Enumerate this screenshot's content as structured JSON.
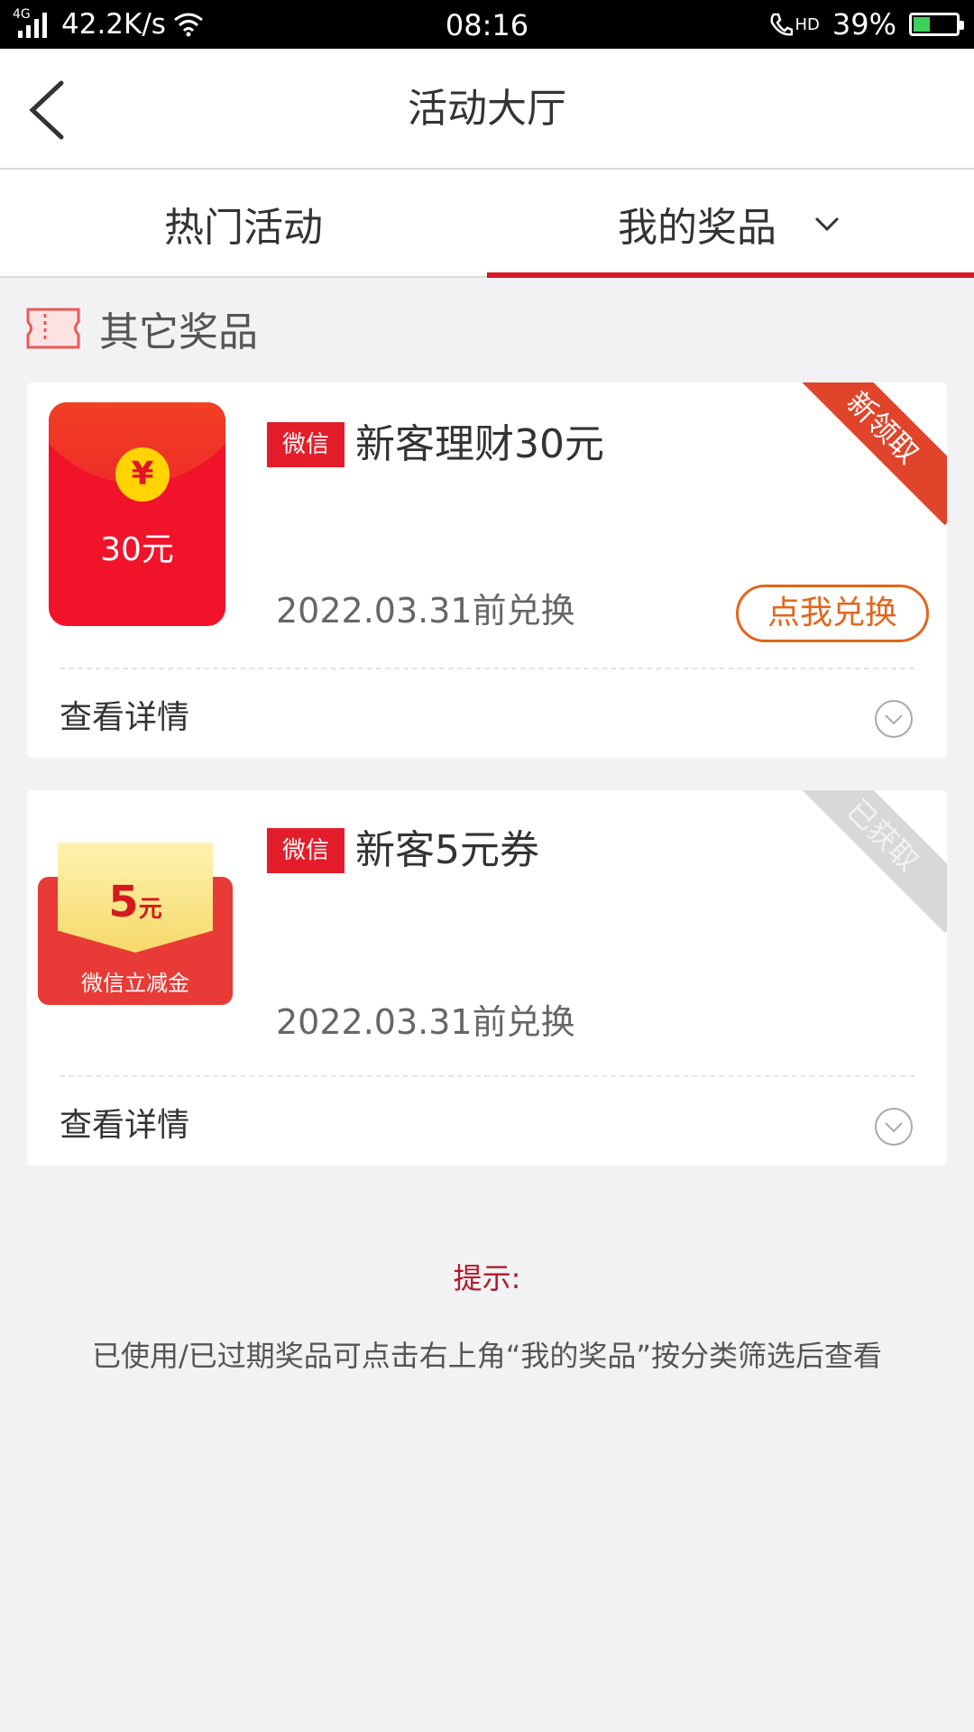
{
  "status_bar": {
    "network": "4G",
    "speed": "42.2K/s",
    "time": "08:16",
    "call_hd": "HD",
    "battery": "39%",
    "battery_level": 0.39
  },
  "header": {
    "title": "活动大厅"
  },
  "tabs": [
    {
      "label": "热门活动",
      "active": false
    },
    {
      "label": "我的奖品",
      "active": true
    }
  ],
  "section": {
    "title": "其它奖品"
  },
  "prizes": [
    {
      "thumb_amount": "30元",
      "thumb_symbol": "¥",
      "tag": "微信",
      "name": "新客理财30元",
      "expire": "2022.03.31前兑换",
      "ribbon": "新领取",
      "redeem_label": "点我兑换",
      "detail_label": "查看详情"
    },
    {
      "thumb_amount": "5",
      "thumb_unit": "元",
      "thumb_sub": "微信立减金",
      "tag": "微信",
      "name": "新客5元券",
      "expire": "2022.03.31前兑换",
      "ribbon": "已获取",
      "detail_label": "查看详情"
    }
  ],
  "tip": {
    "title": "提示:",
    "text": "已使用/已过期奖品可点击右上角“我的奖品”按分类筛选后查看"
  },
  "colors": {
    "accent": "#d6182a",
    "redeem": "#e2661c",
    "tag": "#e31d2a"
  }
}
